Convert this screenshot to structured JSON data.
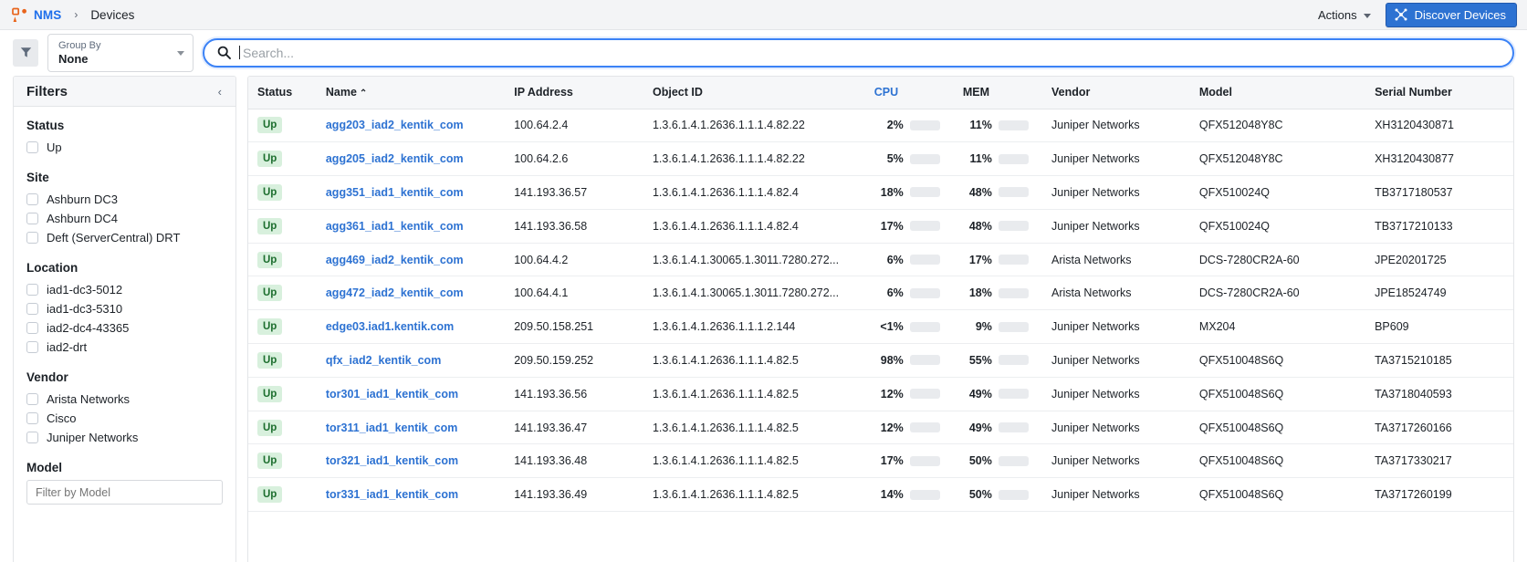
{
  "header": {
    "brand": "NMS",
    "separator": "›",
    "current_page": "Devices",
    "actions_label": "Actions",
    "discover_label": "Discover Devices"
  },
  "toolbar": {
    "group_by_label": "Group By",
    "group_by_value": "None",
    "search_placeholder": "Search...",
    "search_value": ""
  },
  "sidebar": {
    "title": "Filters",
    "collapse_icon": "‹",
    "facets": [
      {
        "title": "Status",
        "options": [
          "Up"
        ]
      },
      {
        "title": "Site",
        "options": [
          "Ashburn DC3",
          "Ashburn DC4",
          "Deft (ServerCentral) DRT"
        ]
      },
      {
        "title": "Location",
        "options": [
          "iad1-dc3-5012",
          "iad1-dc3-5310",
          "iad2-dc4-43365",
          "iad2-drt"
        ]
      },
      {
        "title": "Vendor",
        "options": [
          "Arista Networks",
          "Cisco",
          "Juniper Networks"
        ]
      }
    ],
    "model_facet_title": "Model",
    "model_filter_placeholder": "Filter by Model"
  },
  "table": {
    "columns": [
      {
        "key": "status",
        "label": "Status",
        "sorted": false
      },
      {
        "key": "name",
        "label": "Name",
        "sorted": false,
        "sort_dir": "⌃"
      },
      {
        "key": "ip",
        "label": "IP Address",
        "sorted": false
      },
      {
        "key": "oid",
        "label": "Object ID",
        "sorted": false
      },
      {
        "key": "cpu",
        "label": "CPU",
        "sorted": true
      },
      {
        "key": "mem",
        "label": "MEM",
        "sorted": false
      },
      {
        "key": "vendor",
        "label": "Vendor",
        "sorted": false
      },
      {
        "key": "model",
        "label": "Model",
        "sorted": false
      },
      {
        "key": "serial",
        "label": "Serial Number",
        "sorted": false
      }
    ],
    "rows": [
      {
        "status": "Up",
        "name": "agg203_iad2_kentik_com",
        "ip": "100.64.2.4",
        "oid": "1.3.6.1.4.1.2636.1.1.1.4.82.22",
        "cpu": "2%",
        "cpu_val": 2,
        "mem": "11%",
        "mem_val": 11,
        "vendor": "Juniper Networks",
        "model": "QFX512048Y8C",
        "serial": "XH3120430871"
      },
      {
        "status": "Up",
        "name": "agg205_iad2_kentik_com",
        "ip": "100.64.2.6",
        "oid": "1.3.6.1.4.1.2636.1.1.1.4.82.22",
        "cpu": "5%",
        "cpu_val": 5,
        "mem": "11%",
        "mem_val": 11,
        "vendor": "Juniper Networks",
        "model": "QFX512048Y8C",
        "serial": "XH3120430877"
      },
      {
        "status": "Up",
        "name": "agg351_iad1_kentik_com",
        "ip": "141.193.36.57",
        "oid": "1.3.6.1.4.1.2636.1.1.1.4.82.4",
        "cpu": "18%",
        "cpu_val": 18,
        "mem": "48%",
        "mem_val": 48,
        "vendor": "Juniper Networks",
        "model": "QFX510024Q",
        "serial": "TB3717180537"
      },
      {
        "status": "Up",
        "name": "agg361_iad1_kentik_com",
        "ip": "141.193.36.58",
        "oid": "1.3.6.1.4.1.2636.1.1.1.4.82.4",
        "cpu": "17%",
        "cpu_val": 17,
        "mem": "48%",
        "mem_val": 48,
        "vendor": "Juniper Networks",
        "model": "QFX510024Q",
        "serial": "TB3717210133"
      },
      {
        "status": "Up",
        "name": "agg469_iad2_kentik_com",
        "ip": "100.64.4.2",
        "oid": "1.3.6.1.4.1.30065.1.3011.7280.272...",
        "cpu": "6%",
        "cpu_val": 6,
        "mem": "17%",
        "mem_val": 17,
        "vendor": "Arista Networks",
        "model": "DCS-7280CR2A-60",
        "serial": "JPE20201725"
      },
      {
        "status": "Up",
        "name": "agg472_iad2_kentik_com",
        "ip": "100.64.4.1",
        "oid": "1.3.6.1.4.1.30065.1.3011.7280.272...",
        "cpu": "6%",
        "cpu_val": 6,
        "mem": "18%",
        "mem_val": 18,
        "vendor": "Arista Networks",
        "model": "DCS-7280CR2A-60",
        "serial": "JPE18524749"
      },
      {
        "status": "Up",
        "name": "edge03.iad1.kentik.com",
        "ip": "209.50.158.251",
        "oid": "1.3.6.1.4.1.2636.1.1.1.2.144",
        "cpu": "<1%",
        "cpu_val": 0,
        "mem": "9%",
        "mem_val": 9,
        "vendor": "Juniper Networks",
        "model": "MX204",
        "serial": "BP609"
      },
      {
        "status": "Up",
        "name": "qfx_iad2_kentik_com",
        "ip": "209.50.159.252",
        "oid": "1.3.6.1.4.1.2636.1.1.1.4.82.5",
        "cpu": "98%",
        "cpu_val": 98,
        "mem": "55%",
        "mem_val": 55,
        "vendor": "Juniper Networks",
        "model": "QFX510048S6Q",
        "serial": "TA3715210185"
      },
      {
        "status": "Up",
        "name": "tor301_iad1_kentik_com",
        "ip": "141.193.36.56",
        "oid": "1.3.6.1.4.1.2636.1.1.1.4.82.5",
        "cpu": "12%",
        "cpu_val": 12,
        "mem": "49%",
        "mem_val": 49,
        "vendor": "Juniper Networks",
        "model": "QFX510048S6Q",
        "serial": "TA3718040593"
      },
      {
        "status": "Up",
        "name": "tor311_iad1_kentik_com",
        "ip": "141.193.36.47",
        "oid": "1.3.6.1.4.1.2636.1.1.1.4.82.5",
        "cpu": "12%",
        "cpu_val": 12,
        "mem": "49%",
        "mem_val": 49,
        "vendor": "Juniper Networks",
        "model": "QFX510048S6Q",
        "serial": "TA3717260166"
      },
      {
        "status": "Up",
        "name": "tor321_iad1_kentik_com",
        "ip": "141.193.36.48",
        "oid": "1.3.6.1.4.1.2636.1.1.1.4.82.5",
        "cpu": "17%",
        "cpu_val": 17,
        "mem": "50%",
        "mem_val": 50,
        "vendor": "Juniper Networks",
        "model": "QFX510048S6Q",
        "serial": "TA3717330217"
      },
      {
        "status": "Up",
        "name": "tor331_iad1_kentik_com",
        "ip": "141.193.36.49",
        "oid": "1.3.6.1.4.1.2636.1.1.1.4.82.5",
        "cpu": "14%",
        "cpu_val": 14,
        "mem": "50%",
        "mem_val": 50,
        "vendor": "Juniper Networks",
        "model": "QFX510048S6Q",
        "serial": "TA3717260199"
      }
    ]
  },
  "colors": {
    "brand_blue": "#1f6feb",
    "accent_blue": "#2d72d2",
    "link_blue": "#2d72d2",
    "logo_orange": "#e8641c",
    "status_up_bg": "#d8f0dd",
    "status_up_fg": "#1c6e2e",
    "bar_fill": "#1d7cf2",
    "bar_track": "#e9ebee"
  }
}
